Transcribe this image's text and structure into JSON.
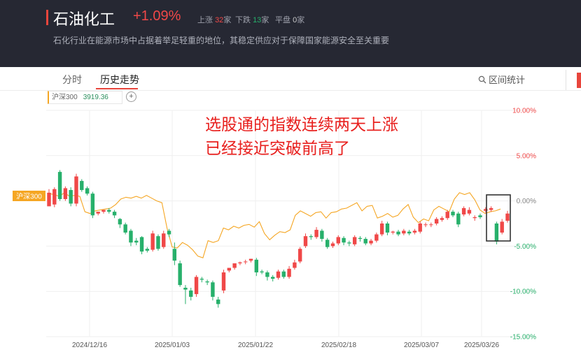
{
  "header": {
    "title": "石油化工",
    "change": "+1.09%",
    "stats": [
      {
        "label": "上涨",
        "value": "32",
        "unit": "家"
      },
      {
        "label": "下跌",
        "value": "13",
        "unit": "家"
      },
      {
        "label": "平盘",
        "value": "0",
        "unit": "家"
      }
    ],
    "description": "石化行业在能源市场中占据着举足轻重的地位，其稳定供应对于保障国家能源安全至关重要"
  },
  "tabs": [
    {
      "label": "分时",
      "active": false
    },
    {
      "label": "历史走势",
      "active": true
    }
  ],
  "range_stats_label": "区间统计",
  "index_selector": {
    "name": "沪深300",
    "value": "3919.36"
  },
  "chart_data": {
    "type": "candlestick",
    "annotation": "选股通的指数连续两天上涨\n已经接近突破前高了",
    "series_tag": "沪深300",
    "y_tick_labels": [
      "10.00%",
      "5.00%",
      "0.00%",
      "-5.00%",
      "-10.00%",
      "-15.00%"
    ],
    "ylim": [
      -15,
      10
    ],
    "x_tick_labels": [
      "2024/12/16",
      "2025/01/03",
      "2025/01/22",
      "2025/02/18",
      "2025/03/07",
      "2025/03/26"
    ],
    "x_tick_index": [
      5,
      19,
      33,
      47,
      61,
      75
    ],
    "up_color": "#f04848",
    "down_color": "#27b06b",
    "line_color": "#f5a623",
    "candles": [
      [
        -0.6,
        0.9,
        -0.4,
        1.3
      ],
      [
        -0.4,
        1.3,
        -0.7,
        1.5
      ],
      [
        3.2,
        0.2,
        3.4,
        0.0
      ],
      [
        0.2,
        1.4,
        0.0,
        1.6
      ],
      [
        1.2,
        -0.3,
        1.5,
        -0.6
      ],
      [
        -0.3,
        2.7,
        -0.6,
        3.0
      ],
      [
        2.2,
        1.2,
        2.4,
        1.0
      ],
      [
        1.4,
        0.8,
        1.6,
        0.6
      ],
      [
        0.8,
        -1.6,
        1.0,
        -1.9
      ],
      [
        -1.4,
        -1.2,
        -1.2,
        -1.6
      ],
      [
        -1.2,
        -1.0,
        -1.0,
        -1.4
      ],
      [
        -1.0,
        -1.2,
        -0.8,
        -1.4
      ],
      [
        -1.2,
        -1.6,
        -1.0,
        -1.9
      ],
      [
        -2.0,
        -2.6,
        -1.9,
        -3.0
      ],
      [
        -2.6,
        -3.5,
        -2.4,
        -3.7
      ],
      [
        -3.3,
        -4.6,
        -3.1,
        -5.0
      ],
      [
        -4.4,
        -4.6,
        -4.1,
        -4.9
      ],
      [
        -4.0,
        -5.6,
        -3.9,
        -5.9
      ],
      [
        -5.3,
        -5.5,
        -5.1,
        -5.7
      ],
      [
        -5.4,
        -3.6,
        -5.6,
        -3.3
      ],
      [
        -3.9,
        -5.3,
        -3.7,
        -5.5
      ],
      [
        -5.1,
        -3.6,
        -5.3,
        -3.3
      ],
      [
        -3.3,
        -3.7,
        -3.1,
        -4.0
      ],
      [
        -5.3,
        -6.6,
        -4.6,
        -7.1
      ],
      [
        -6.9,
        -9.3,
        -6.6,
        -9.5
      ],
      [
        -9.6,
        -9.8,
        -9.3,
        -11.4
      ],
      [
        -9.9,
        -10.6,
        -9.6,
        -11.0
      ],
      [
        -10.3,
        -8.4,
        -10.6,
        -8.2
      ],
      [
        -8.6,
        -8.7,
        -8.4,
        -9.0
      ],
      [
        -8.9,
        -9.0,
        -8.7,
        -9.3
      ],
      [
        -9.0,
        -10.6,
        -8.8,
        -11.0
      ],
      [
        -10.9,
        -11.4,
        -10.6,
        -11.8
      ],
      [
        -9.9,
        -7.9,
        -10.2,
        -7.6
      ],
      [
        -7.7,
        -7.4,
        -7.5,
        -7.9
      ],
      [
        -7.4,
        -6.9,
        -7.2,
        -7.6
      ],
      [
        -6.9,
        -6.8,
        -6.7,
        -7.1
      ],
      [
        -6.7,
        -6.7,
        -6.5,
        -7.0
      ],
      [
        -6.6,
        -6.4,
        -6.4,
        -6.8
      ],
      [
        -6.5,
        -7.9,
        -6.3,
        -8.3
      ],
      [
        -7.8,
        -7.9,
        -7.6,
        -8.1
      ],
      [
        -7.9,
        -8.4,
        -7.7,
        -8.8
      ],
      [
        -8.4,
        -8.6,
        -8.2,
        -8.9
      ],
      [
        -8.5,
        -7.8,
        -8.7,
        -7.6
      ],
      [
        -7.8,
        -8.4,
        -7.6,
        -8.6
      ],
      [
        -8.4,
        -7.5,
        -8.6,
        -7.2
      ],
      [
        -7.4,
        -6.8,
        -7.6,
        -6.5
      ],
      [
        -6.7,
        -5.3,
        -6.9,
        -5.1
      ],
      [
        -5.0,
        -3.9,
        -5.2,
        -3.6
      ],
      [
        -3.9,
        -4.0,
        -3.7,
        -4.3
      ],
      [
        -4.0,
        -3.2,
        -4.2,
        -2.9
      ],
      [
        -3.3,
        -4.2,
        -3.1,
        -4.5
      ],
      [
        -4.3,
        -5.1,
        -4.1,
        -5.3
      ],
      [
        -5.0,
        -4.7,
        -5.2,
        -4.5
      ],
      [
        -4.7,
        -4.0,
        -4.9,
        -3.8
      ],
      [
        -4.1,
        -4.6,
        -3.9,
        -4.9
      ],
      [
        -4.6,
        -4.7,
        -4.4,
        -5.0
      ],
      [
        -4.8,
        -4.0,
        -5.0,
        -3.8
      ],
      [
        -4.1,
        -4.2,
        -3.9,
        -4.5
      ],
      [
        -4.2,
        -4.7,
        -4.0,
        -4.9
      ],
      [
        -4.7,
        -4.4,
        -4.9,
        -4.2
      ],
      [
        -4.4,
        -3.7,
        -4.6,
        -3.5
      ],
      [
        -3.7,
        -2.5,
        -3.9,
        -2.2
      ],
      [
        -2.5,
        -3.5,
        -2.3,
        -3.8
      ],
      [
        -3.5,
        -3.4,
        -3.3,
        -3.7
      ],
      [
        -3.4,
        -3.7,
        -3.2,
        -3.9
      ],
      [
        -3.6,
        -3.3,
        -3.8,
        -3.1
      ],
      [
        -3.4,
        -3.6,
        -3.2,
        -3.8
      ],
      [
        -3.5,
        -3.3,
        -3.7,
        -3.1
      ],
      [
        -3.4,
        -2.5,
        -3.6,
        -2.3
      ],
      [
        -2.6,
        -2.6,
        -2.4,
        -2.9
      ],
      [
        -2.6,
        -2.6,
        -2.4,
        -2.9
      ],
      [
        -2.5,
        -2.0,
        -2.7,
        -1.8
      ],
      [
        -2.1,
        -1.9,
        -2.3,
        -1.7
      ],
      [
        -1.9,
        -1.2,
        -2.1,
        -1.0
      ],
      [
        -1.2,
        -1.6,
        -1.0,
        -1.8
      ],
      [
        -1.4,
        -2.6,
        -1.2,
        -2.9
      ],
      [
        -1.5,
        -0.8,
        -1.7,
        -0.6
      ],
      [
        -1.4,
        -1.0,
        -1.6,
        -0.7
      ],
      [
        -1.9,
        -1.8,
        -1.6,
        -2.2
      ],
      [
        -1.6,
        -1.8,
        -1.4,
        -2.0
      ],
      [
        -1.1,
        -0.9,
        -1.3,
        -0.7
      ],
      [
        -1.0,
        -0.8,
        -1.2,
        -0.6
      ],
      [
        -2.5,
        -4.5,
        -2.3,
        -4.8
      ],
      [
        -3.5,
        -2.3,
        -3.7,
        -2.0
      ],
      [
        -2.2,
        -1.4,
        -2.4,
        -1.1
      ]
    ],
    "benchmark": [
      0.8,
      0.7,
      0.5,
      0.9,
      0.5,
      0.6,
      0.5,
      -1.2,
      -1.4,
      -1.1,
      -1.0,
      -0.9,
      -0.8,
      -0.4,
      0.2,
      0.4,
      0.3,
      0.5,
      0.3,
      0.6,
      0.3,
      0.0,
      -0.2,
      -3.0,
      -5.1,
      -5.2,
      -4.6,
      -4.9,
      -5.4,
      -6.1,
      -6.3,
      -4.4,
      -4.6,
      -4.4,
      -3.0,
      -3.2,
      -2.8,
      -3.0,
      -2.7,
      -2.6,
      -2.9,
      -2.3,
      -3.6,
      -4.3,
      -3.8,
      -3.4,
      -3.5,
      -3.2,
      -1.6,
      -1.1,
      -1.4,
      -1.7,
      -1.3,
      -1.2,
      -1.9,
      -1.3,
      -1.2,
      -0.9,
      -0.8,
      -0.5,
      -0.2,
      -1.1,
      -0.6,
      -0.5,
      -1.9,
      -1.7,
      -1.4,
      -1.8,
      -1.6,
      -0.9,
      -0.4,
      -1.8,
      -2.4,
      -2.0,
      -2.2,
      -1.0,
      -0.6,
      -0.9,
      -1.2,
      0.2,
      0.9,
      0.7,
      0.9,
      0.1,
      -1.0,
      -1.4,
      -1.2,
      -1.1,
      -0.9
    ]
  }
}
